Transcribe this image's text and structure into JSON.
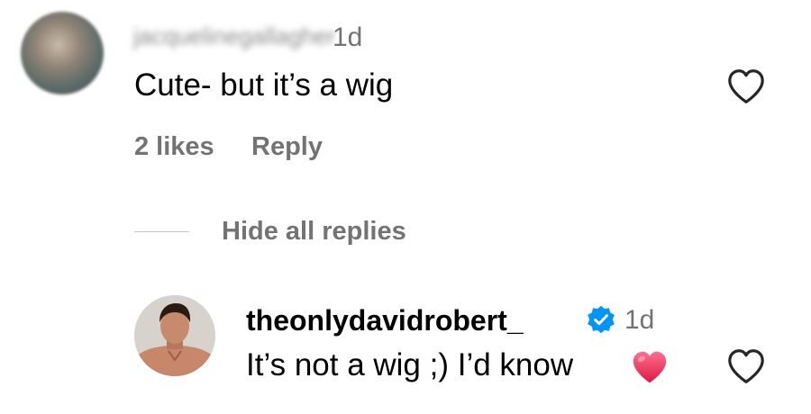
{
  "comment": {
    "username": "jacquelinegallagher",
    "time": "1d",
    "text": "Cute- but it’s a wig",
    "likes": "2 likes",
    "reply_label": "Reply"
  },
  "replies_toggle": {
    "label": "Hide all replies"
  },
  "reply": {
    "username": "theonlydavidrobert_",
    "verified": true,
    "time": "1d",
    "text": "It’s not a wig ;) I’d know",
    "emoji": "heart"
  },
  "icons": {
    "like": "heart-outline-icon",
    "verified": "verified-badge-icon",
    "emoji": "red-heart-emoji"
  },
  "colors": {
    "secondary_text": "#737373",
    "verified_blue": "#0095f6",
    "emoji_red": "#e8305a"
  }
}
